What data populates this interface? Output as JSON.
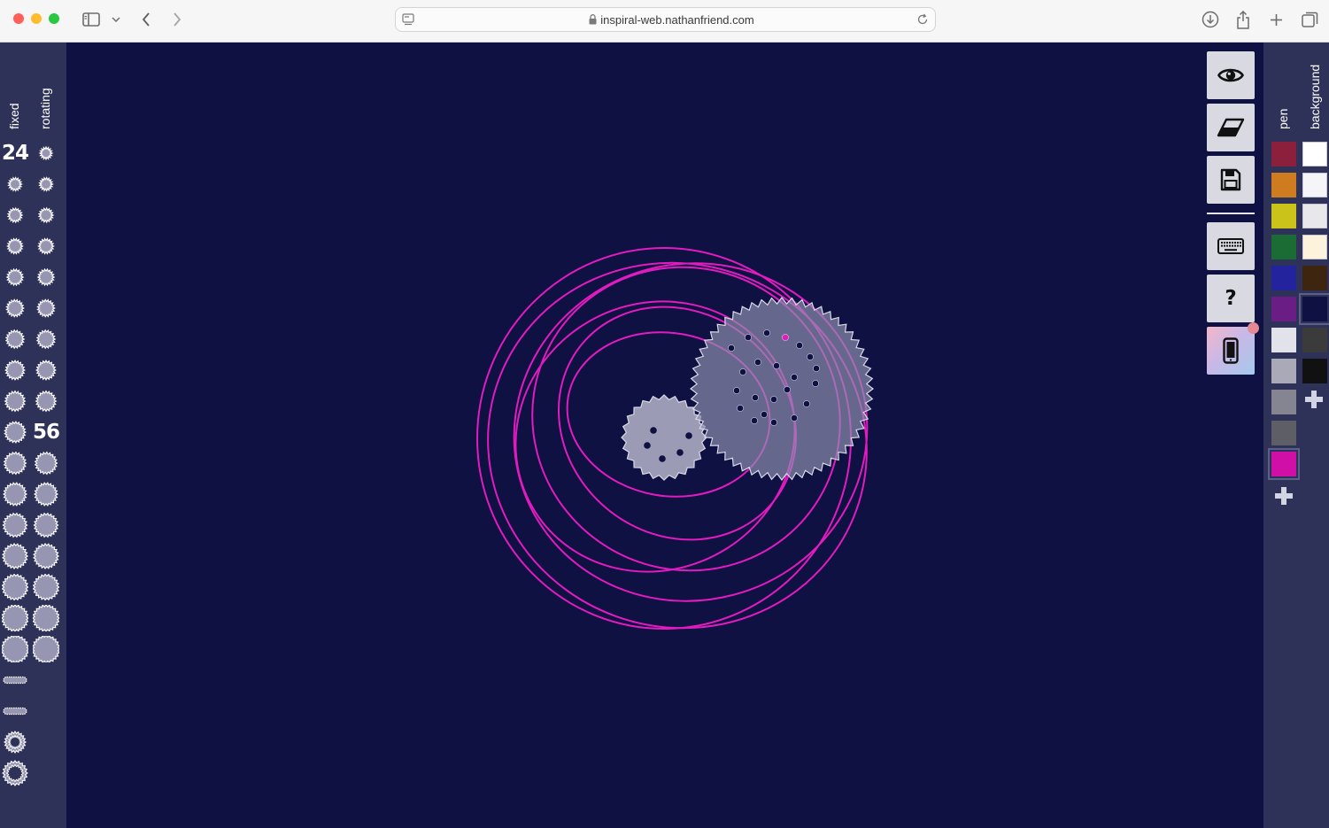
{
  "browser": {
    "url": "inspiral-web.nathanfriend.com",
    "traffic_lights": [
      "#fe5f57",
      "#febc2e",
      "#28c840"
    ]
  },
  "gear_sidebar": {
    "fixed_label": "fixed",
    "rotating_label": "rotating",
    "selected_fixed_label": "24",
    "selected_rotating_label": "56"
  },
  "canvas": {
    "background": "#0f1142",
    "pen_color": "#e21bc0"
  },
  "tools": [
    "eye-icon",
    "eraser-icon",
    "save-icon",
    "keyboard-icon",
    "help-icon",
    "phone-icon"
  ],
  "tool_help_label": "?",
  "color_panel": {
    "pen_label": "pen",
    "background_label": "background",
    "pen_colors": [
      "#8c1f3b",
      "#cf7b1f",
      "#c9c31a",
      "#1a6b34",
      "#23249d",
      "#6a1d85",
      "#e2e2ea",
      "#a9a9b7",
      "#858591",
      "#5e5e66",
      "#cf0fa5"
    ],
    "selected_pen_index": 10,
    "background_colors": [
      "#ffffff",
      "#f5f5f7",
      "#e8e8ea",
      "#fdf3dd",
      "#3d2510",
      "#0f1142",
      "#3b3b3b",
      "#111111"
    ],
    "selected_background_index": 5
  }
}
